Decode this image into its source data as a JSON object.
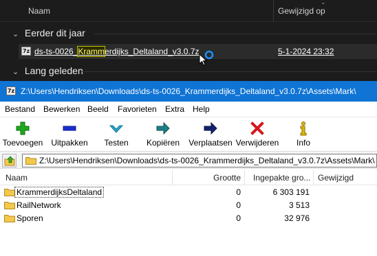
{
  "explorer": {
    "columns": {
      "name": "Naam",
      "modified": "Gewijzigd op"
    },
    "groups": [
      "Eerder dit jaar",
      "Lang geleden"
    ],
    "file": {
      "name_before": "ds-ts-0026_",
      "name_highlight": "Kramm",
      "name_after": "erdijks_Deltaland_v3.0.7z",
      "icon": "7z",
      "modified": "5-1-2024 23:32"
    }
  },
  "zip": {
    "title": "Z:\\Users\\Hendriksen\\Downloads\\ds-ts-0026_Krammerdijks_Deltaland_v3.0.7z\\Assets\\Mark\\",
    "title_icon": "7z",
    "menu": [
      "Bestand",
      "Bewerken",
      "Beeld",
      "Favorieten",
      "Extra",
      "Help"
    ],
    "toolbar": [
      {
        "label": "Toevoegen",
        "icon": "plus-icon",
        "color": "#1fa81f"
      },
      {
        "label": "Uitpakken",
        "icon": "minus-icon",
        "color": "#1a2fd0"
      },
      {
        "label": "Testen",
        "icon": "test-icon",
        "color": "#2aa6c8"
      },
      {
        "label": "Kopiëren",
        "icon": "copy-icon",
        "color": "#1e7e84"
      },
      {
        "label": "Verplaatsen",
        "icon": "move-icon",
        "color": "#14236e"
      },
      {
        "label": "Verwijderen",
        "icon": "delete-icon",
        "color": "#d4161b"
      },
      {
        "label": "Info",
        "icon": "info-icon",
        "color": "#e0b800"
      }
    ],
    "address": "Z:\\Users\\Hendriksen\\Downloads\\ds-ts-0026_Krammerdijks_Deltaland_v3.0.7z\\Assets\\Mark\\",
    "columns": {
      "name": "Naam",
      "size": "Grootte",
      "packed": "Ingepakte gro...",
      "modified": "Gewijzigd"
    },
    "rows": [
      {
        "name": "KrammerdijksDeltaland",
        "size": "0",
        "packed": "6 303 191",
        "modified": ""
      },
      {
        "name": "RailNetwork",
        "size": "0",
        "packed": "3 513",
        "modified": ""
      },
      {
        "name": "Sporen",
        "size": "0",
        "packed": "32 976",
        "modified": ""
      }
    ]
  }
}
